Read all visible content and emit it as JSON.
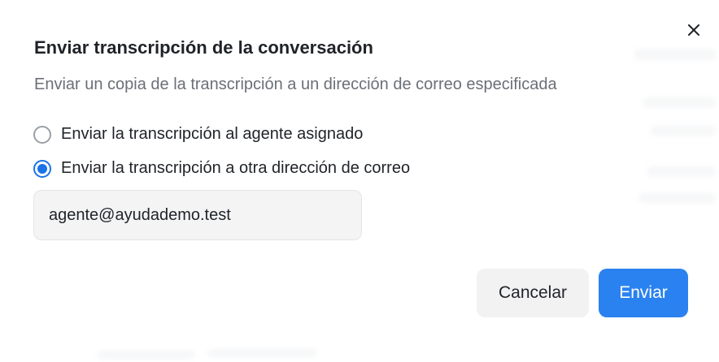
{
  "dialog": {
    "title": "Enviar transcripción de la conversación",
    "subtitle": "Enviar un copia de la transcripción a un dirección de correo especificada",
    "options": [
      {
        "label": "Enviar la transcripción al agente asignado",
        "checked": false
      },
      {
        "label": "Enviar la transcripción a otra dirección de correo",
        "checked": true
      }
    ],
    "email_value": "agente@ayudademo.test",
    "cancel_label": "Cancelar",
    "send_label": "Enviar",
    "close_icon": "close-icon"
  },
  "colors": {
    "accent": "#1a73e8",
    "primary_button": "#2a82f0",
    "secondary_button": "#f2f2f3",
    "input_background": "#f4f4f5"
  }
}
